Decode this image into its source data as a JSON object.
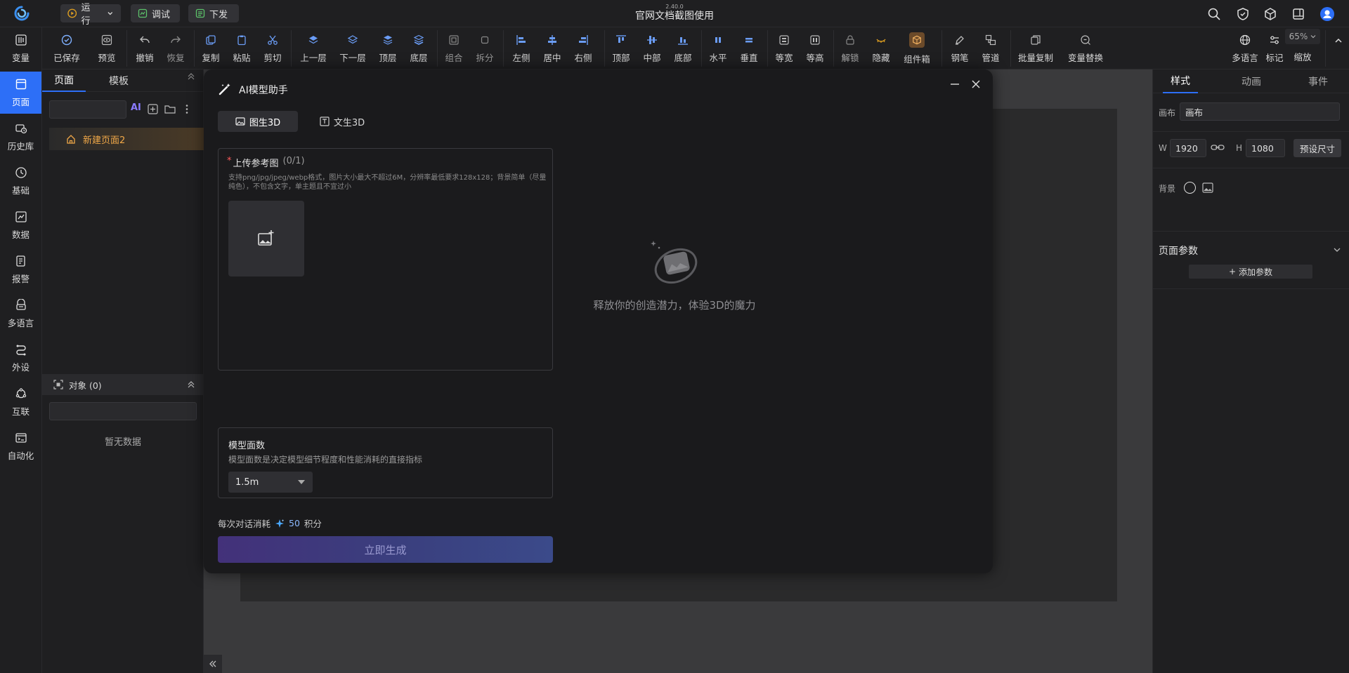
{
  "topbar": {
    "run_label": "运行",
    "debug_label": "调试",
    "deploy_label": "下发",
    "version": "2.40.0",
    "title": "官网文档截图使用"
  },
  "toolbar": {
    "items": [
      "已保存",
      "预览",
      "撤销",
      "恢复",
      "复制",
      "粘贴",
      "剪切",
      "上一层",
      "下一层",
      "顶层",
      "底层",
      "组合",
      "拆分",
      "左侧",
      "居中",
      "右侧",
      "顶部",
      "中部",
      "底部",
      "水平",
      "垂直",
      "等宽",
      "等高",
      "解锁",
      "隐藏",
      "组件箱",
      "钢笔",
      "管道",
      "批量复制",
      "变量替换"
    ],
    "right_items": [
      "多语言",
      "标记",
      "缩放"
    ],
    "zoom": "65%"
  },
  "leftnav": {
    "items": [
      "变量",
      "页面",
      "历史库",
      "基础",
      "数据",
      "报警",
      "多语言",
      "外设",
      "互联",
      "自动化"
    ]
  },
  "pagepanel": {
    "tab_pages": "页面",
    "tab_templates": "模板",
    "ai_label": "AI",
    "page_item": "新建页面2",
    "objects_label": "对象 (0)",
    "empty_text": "暂无数据"
  },
  "rightpanel": {
    "tabs": [
      "样式",
      "动画",
      "事件"
    ],
    "canvas_label": "画布",
    "canvas_value": "画布",
    "w_label": "W",
    "w_value": "1920",
    "h_label": "H",
    "h_value": "1080",
    "preset_label": "预设尺寸",
    "bg_label": "背景",
    "params_label": "页面参数",
    "add_param_label": "添加参数"
  },
  "modal": {
    "title": "AI模型助手",
    "tab_image": "图生3D",
    "tab_text": "文生3D",
    "upload_required": "*",
    "upload_label": "上传参考图",
    "upload_count": "(0/1)",
    "upload_hint": "支持png/jpg/jpeg/webp格式，图片大小最大不超过6M，分辨率最低要求128x128；背景简单（尽量纯色），不包含文字，单主题且不宜过小",
    "faces_label": "模型面数",
    "faces_desc": "模型面数是决定模型细节程度和性能消耗的直接指标",
    "faces_value": "1.5m",
    "cost_prefix": "每次对话消耗",
    "cost_value": "50",
    "cost_unit": "积分",
    "generate_label": "立即生成",
    "placeholder_text": "释放你的创造潜力，体验3D的魔力"
  }
}
